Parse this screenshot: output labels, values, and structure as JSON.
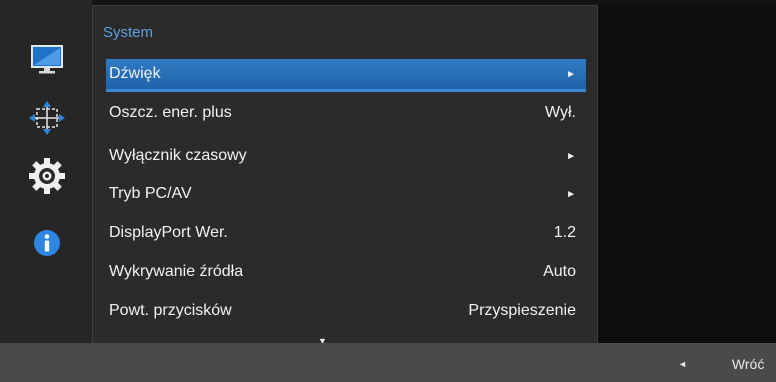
{
  "sidebar": {
    "icons": [
      "monitor-icon",
      "move-icon",
      "gear-icon",
      "info-icon"
    ]
  },
  "menu": {
    "title": "System",
    "items": [
      {
        "label": "Dźwięk",
        "value": "►"
      },
      {
        "label": "Oszcz. ener. plus",
        "value": "Wył."
      },
      {
        "label": "Wyłącznik czasowy",
        "value": "►"
      },
      {
        "label": "Tryb PC/AV",
        "value": "►"
      },
      {
        "label": "DisplayPort Wer.",
        "value": "1.2"
      },
      {
        "label": "Wykrywanie źródła",
        "value": "Auto"
      },
      {
        "label": "Powt. przycisków",
        "value": "Przyspieszenie"
      }
    ],
    "scroll_indicator": "▼"
  },
  "footer": {
    "back_arrow": "◄",
    "back_label": "Wróć"
  },
  "colors": {
    "accent": "#2f7bc4",
    "title": "#5a9fe0"
  }
}
